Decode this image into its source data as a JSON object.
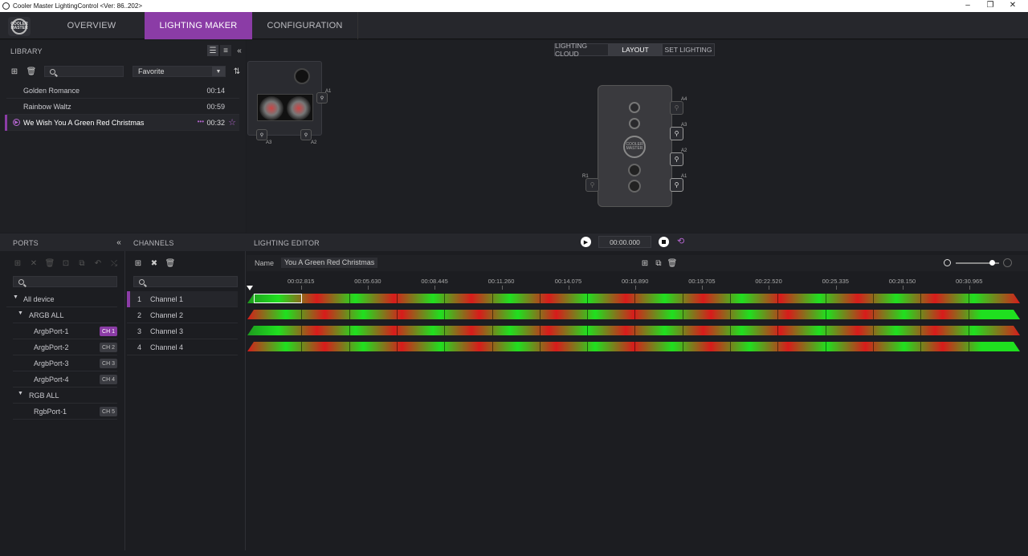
{
  "window": {
    "title": "Cooler Master LightingControl <Ver: 86..202>",
    "minimize_icon": "minimize-icon",
    "maximize_icon": "maximize-icon",
    "close_icon": "close-icon"
  },
  "nav": {
    "logo_text": "COOLER MASTER",
    "tabs": [
      {
        "label": "OVERVIEW",
        "active": false
      },
      {
        "label": "LIGHTING MAKER",
        "active": true
      },
      {
        "label": "CONFIGURATION",
        "active": false
      }
    ],
    "accent_color": "#8b3ca6"
  },
  "library": {
    "title": "LIBRARY",
    "filter_value": "Favorite",
    "items": [
      {
        "name": "Golden Romance",
        "duration": "00:14",
        "selected": false
      },
      {
        "name": "Rainbow Waltz",
        "duration": "00:59",
        "selected": false
      },
      {
        "name": "We Wish You A Green Red Christmas",
        "duration": "00:32",
        "selected": true,
        "more": "•••"
      }
    ]
  },
  "device_preview": {
    "port_labels": [
      "A1",
      "A3",
      "A2"
    ]
  },
  "view_switch": {
    "items": [
      {
        "label": "LIGHTING CLOUD",
        "active": false
      },
      {
        "label": "LAYOUT",
        "active": true
      },
      {
        "label": "SET LIGHTING",
        "active": false
      }
    ]
  },
  "hub": {
    "logo_text": "COOLER MASTER",
    "ports": [
      "A4",
      "A3",
      "A2",
      "A1",
      "R1"
    ]
  },
  "ports": {
    "title": "PORTS",
    "tree": [
      {
        "label": "All device",
        "level": 0,
        "badge": ""
      },
      {
        "label": "ARGB ALL",
        "level": 1,
        "badge": ""
      },
      {
        "label": "ArgbPort-1",
        "level": 2,
        "badge": "CH 1",
        "active": true
      },
      {
        "label": "ArgbPort-2",
        "level": 2,
        "badge": "CH 2"
      },
      {
        "label": "ArgbPort-3",
        "level": 2,
        "badge": "CH 3"
      },
      {
        "label": "ArgbPort-4",
        "level": 2,
        "badge": "CH 4"
      },
      {
        "label": "RGB ALL",
        "level": 1,
        "badge": ""
      },
      {
        "label": "RgbPort-1",
        "level": 2,
        "badge": "CH 5"
      }
    ]
  },
  "channels": {
    "title": "CHANNELS",
    "items": [
      {
        "num": "1",
        "label": "Channel 1",
        "selected": true
      },
      {
        "num": "2",
        "label": "Channel 2"
      },
      {
        "num": "3",
        "label": "Channel 3"
      },
      {
        "num": "4",
        "label": "Channel 4"
      }
    ]
  },
  "editor": {
    "title": "LIGHTING EDITOR",
    "time": "00:00.000",
    "name_label": "Name",
    "name_value": "You A Green Red Christmas",
    "ticks": [
      "00:02.815",
      "00:05.630",
      "00:08.445",
      "00:11.260",
      "00:14.075",
      "00:16.890",
      "00:19.705",
      "00:22.520",
      "00:25.335",
      "00:28.150",
      "00:30.965"
    ],
    "zoom": 0.83
  }
}
